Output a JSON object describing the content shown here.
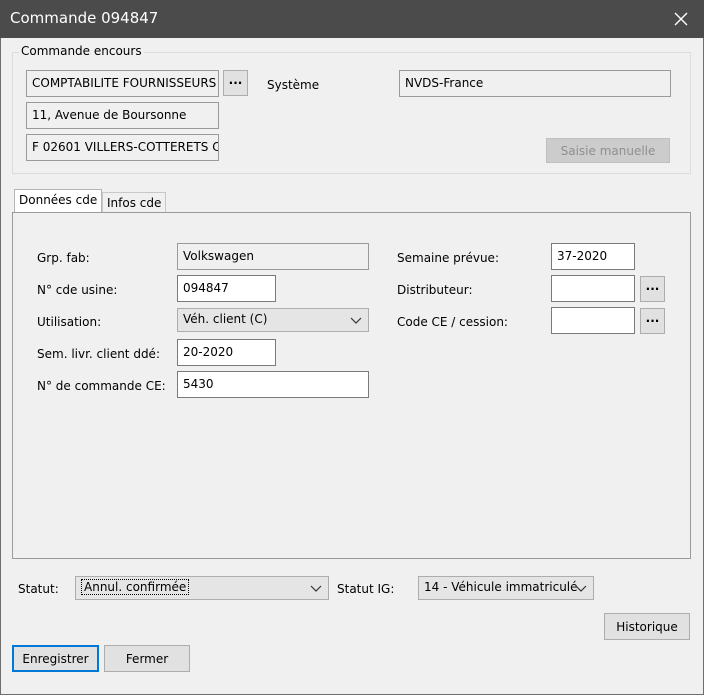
{
  "window": {
    "title": "Commande 094847"
  },
  "group": {
    "label": "Commande encours",
    "supplier": "COMPTABILITE FOURNISSEURS",
    "address1": "11, Avenue de Boursonne",
    "address2": "F 02601 VILLERS-COTTERETS C",
    "browse_label": "...",
    "systeme_label": "Système",
    "systeme_value": "NVDS-France",
    "manual_button": "Saisie manuelle"
  },
  "tabs": [
    {
      "label": "Données cde",
      "active": true
    },
    {
      "label": "Infos cde",
      "active": false
    }
  ],
  "form": {
    "grp_fab_label": "Grp. fab:",
    "grp_fab_value": "Volkswagen",
    "cde_usine_label": "N° cde usine:",
    "cde_usine_value": "094847",
    "utilisation_label": "Utilisation:",
    "utilisation_value": "Véh. client (C)",
    "sem_livr_label": "Sem. livr. client ddé:",
    "sem_livr_value": "20-2020",
    "cmd_ce_label": "N° de commande CE:",
    "cmd_ce_value": "5430",
    "semaine_prevue_label": "Semaine prévue:",
    "semaine_prevue_value": "37-2020",
    "distributeur_label": "Distributeur:",
    "distributeur_value": "",
    "code_ce_label": "Code CE / cession:",
    "code_ce_value": "",
    "browse_label": "..."
  },
  "status": {
    "statut_label": "Statut:",
    "statut_value": "Annul. confirmée",
    "statut_ig_label": "Statut IG:",
    "statut_ig_value": "14 - Véhicule immatriculé"
  },
  "buttons": {
    "historique": "Historique",
    "enregistrer": "Enregistrer",
    "fermer": "Fermer"
  },
  "colors": {
    "titlebar": "#4b4b4b",
    "accent": "#0078d7",
    "background": "#f0f0f0"
  }
}
